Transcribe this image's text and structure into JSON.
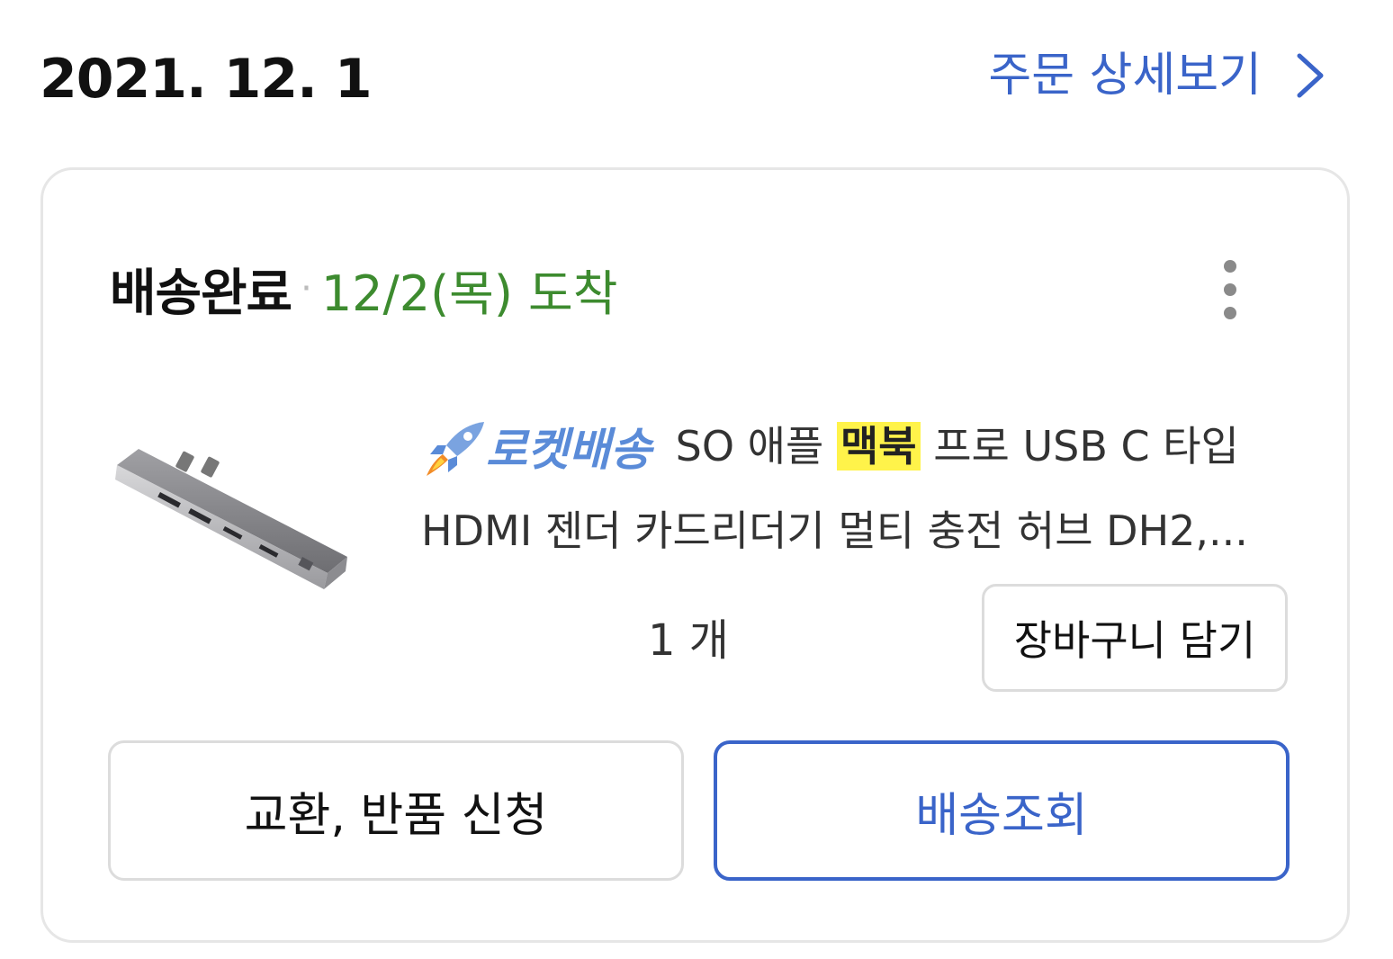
{
  "header": {
    "order_date": "2021. 12. 1",
    "detail_link_label": "주문 상세보기"
  },
  "order_card": {
    "status": "배송완료",
    "arrival": "12/2(목) 도착",
    "product": {
      "badge_label": "로켓배송",
      "title_prefix": "SO 애플",
      "title_highlight": "맥북",
      "title_suffix": "프로 USB C 타입",
      "title_line2": "HDMI 젠더 카드리더기 멀티 충전 허브 DH2,...",
      "quantity": "1 개"
    },
    "buttons": {
      "add_to_cart": "장바구니 담기",
      "exchange_return": "교환, 반품 신청",
      "track_delivery": "배송조회"
    }
  },
  "colors": {
    "link_blue": "#3a64c9",
    "arrival_green": "#3d8b2f",
    "highlight_yellow": "#fff34a",
    "rocket_blue": "#5a8bd8"
  },
  "icons": {
    "detail_chevron": "chevron-right-icon",
    "more_menu": "more-vertical-icon",
    "rocket": "rocket-icon"
  }
}
